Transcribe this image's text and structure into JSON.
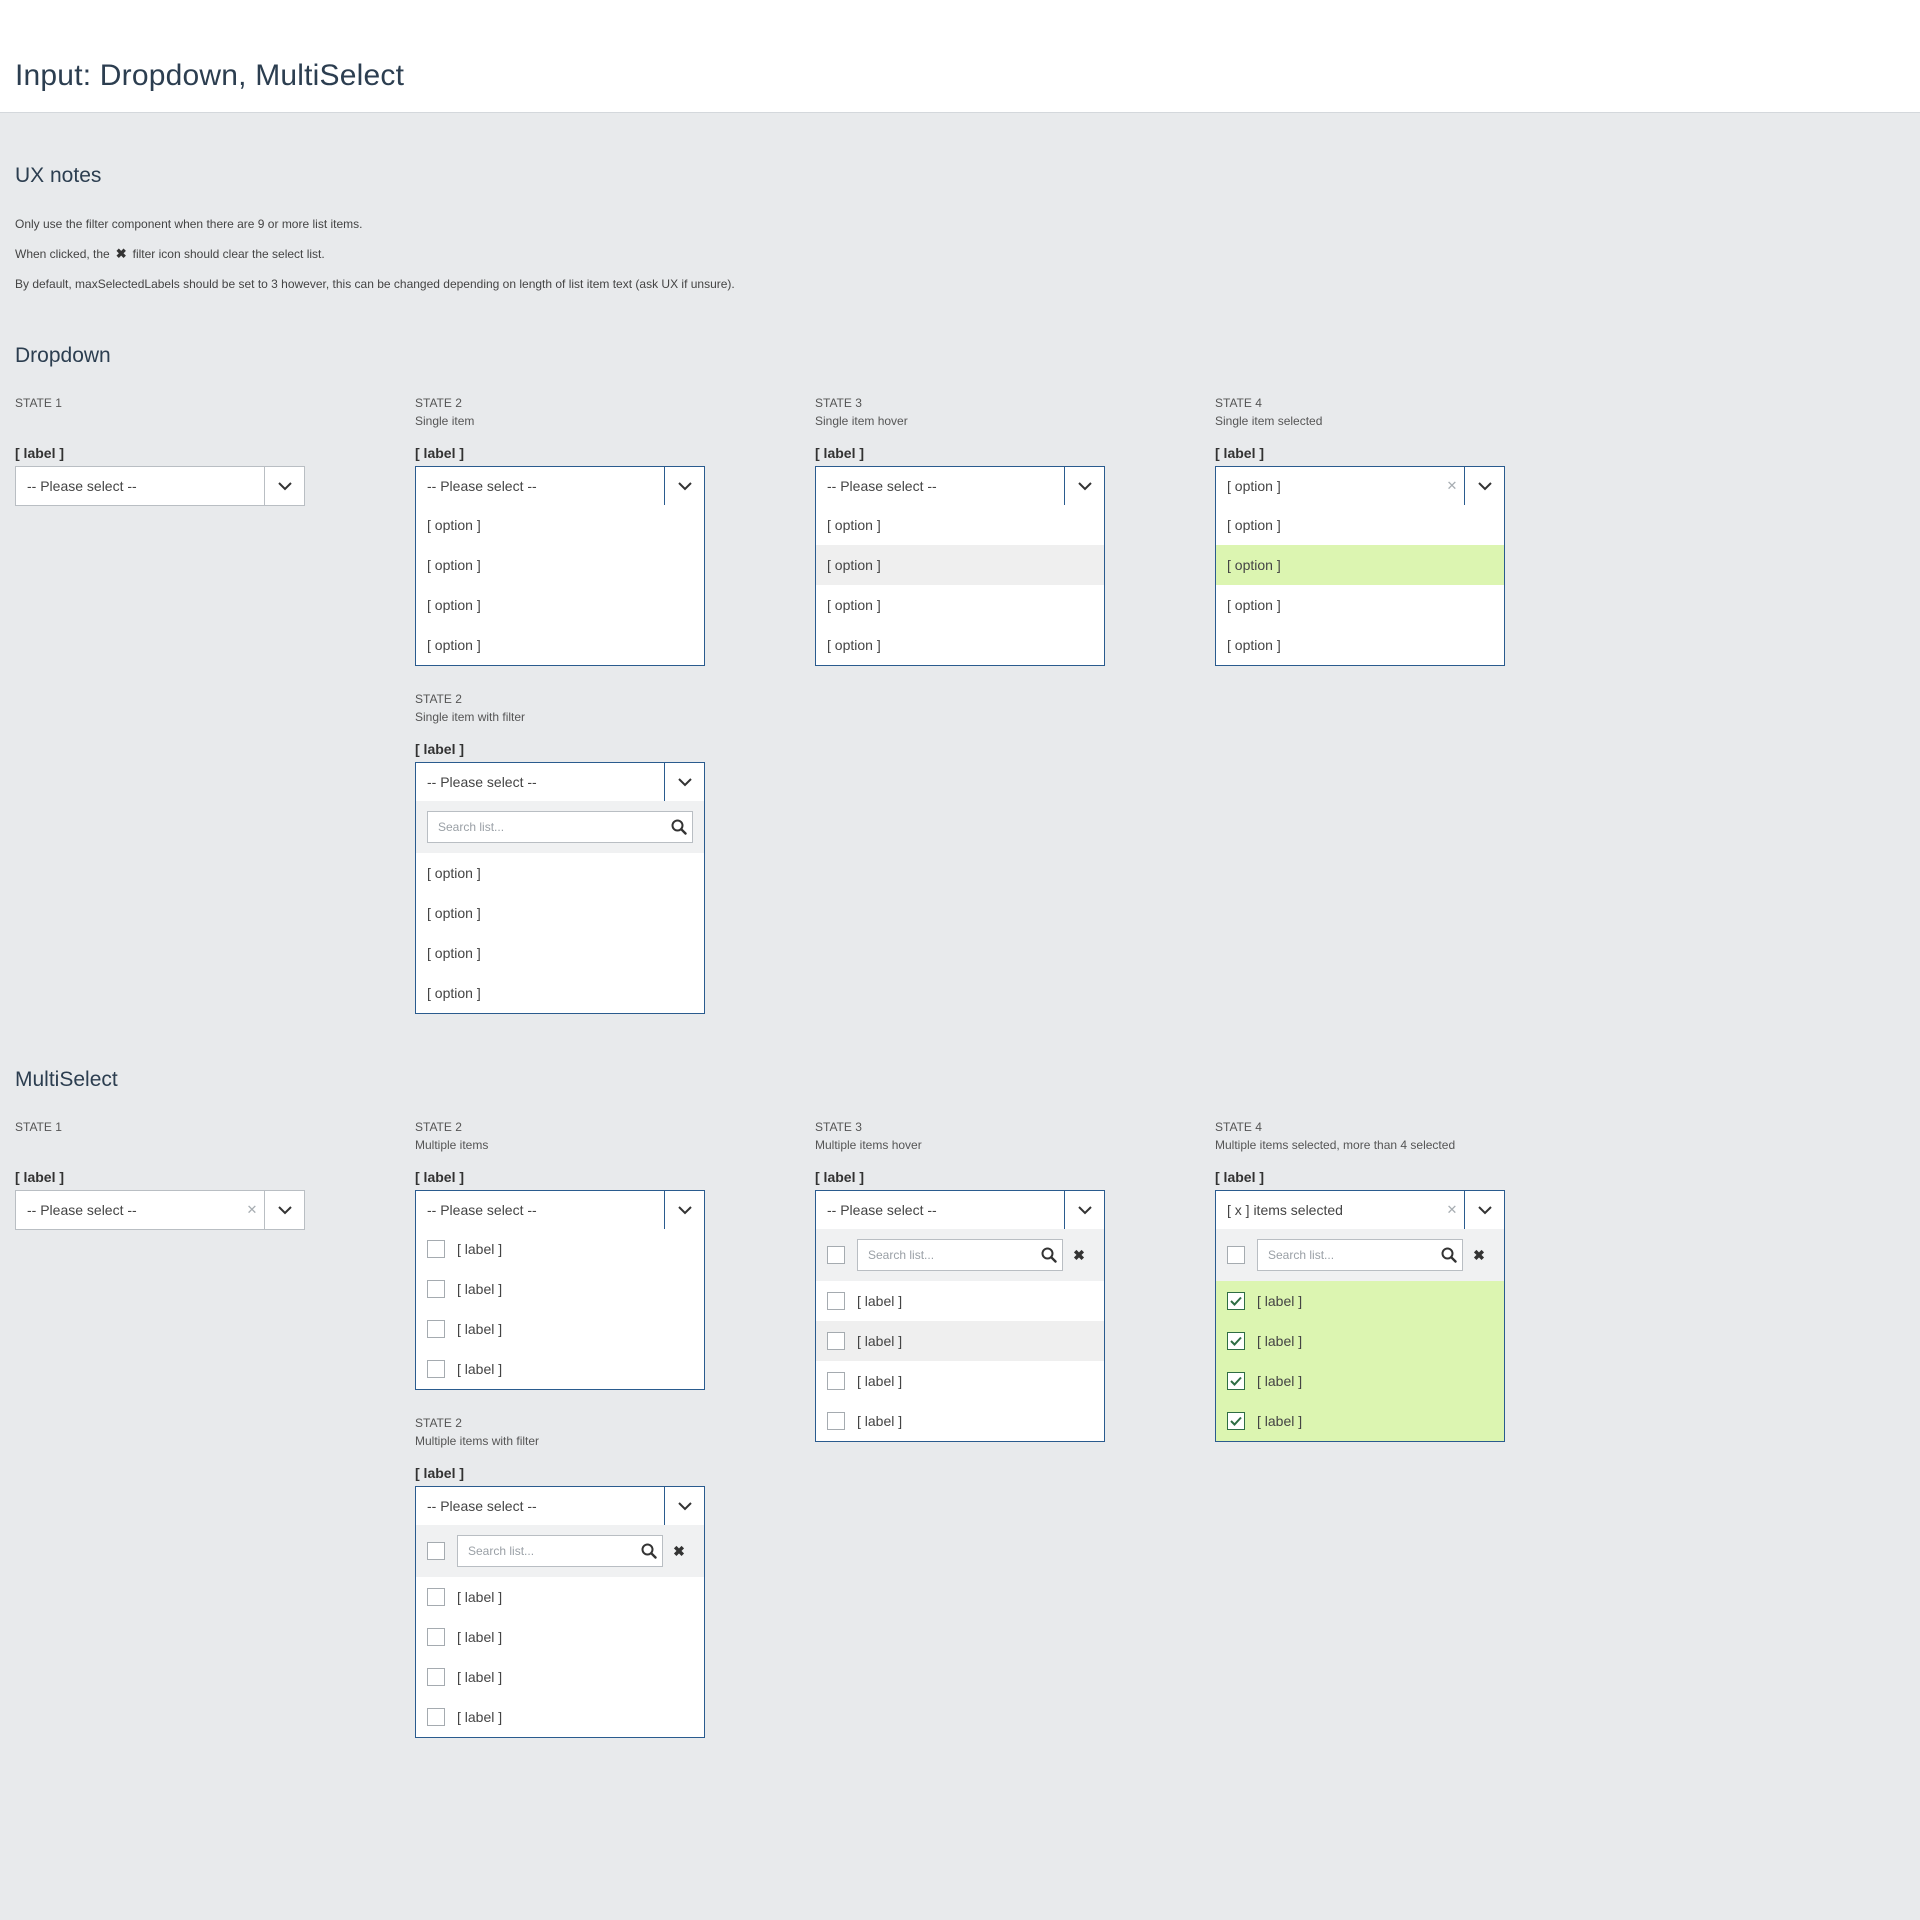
{
  "page": {
    "title": "Input: Dropdown, MultiSelect"
  },
  "ux": {
    "heading": "UX notes",
    "note1": "Only use the filter component when there are 9 or more list items.",
    "note2_before": "When clicked, the",
    "note2_icon": "✖",
    "note2_after": "filter icon should clear the select list.",
    "note3": "By default, maxSelectedLabels should be set to 3 however, this can be changed depending on length of list item text (ask UX if unsure)."
  },
  "dropdown": {
    "heading": "Dropdown",
    "s1": {
      "state": "STATE 1",
      "label": "[ label ]",
      "value": "-- Please select --"
    },
    "s2": {
      "state": "STATE 2",
      "desc": "Single item",
      "label": "[ label ]",
      "value": "-- Please select --",
      "options": [
        "[ option ]",
        "[ option ]",
        "[ option ]",
        "[ option ]"
      ]
    },
    "s3": {
      "state": "STATE 3",
      "desc": "Single item hover",
      "label": "[ label ]",
      "value": "-- Please select --",
      "options": [
        "[ option ]",
        "[ option ]",
        "[ option ]",
        "[ option ]"
      ]
    },
    "s4": {
      "state": "STATE 4",
      "desc": "Single item selected",
      "label": "[ label ]",
      "value": "[ option ]",
      "clear": "✕",
      "options": [
        "[ option ]",
        "[ option ]",
        "[ option ]",
        "[ option ]"
      ]
    },
    "s2f": {
      "state": "STATE 2",
      "desc": "Single item with filter",
      "label": "[ label ]",
      "value": "-- Please select --",
      "search_placeholder": "Search list...",
      "options": [
        "[ option ]",
        "[ option ]",
        "[ option ]",
        "[ option ]"
      ]
    }
  },
  "multiselect": {
    "heading": "MultiSelect",
    "s1": {
      "state": "STATE 1",
      "label": "[ label ]",
      "value": "-- Please select --",
      "clear": "✕"
    },
    "s2": {
      "state": "STATE 2",
      "desc": "Multiple items",
      "label": "[ label ]",
      "value": "-- Please select --",
      "items": [
        "[ label ]",
        "[ label ]",
        "[ label ]",
        "[ label ]"
      ]
    },
    "s3": {
      "state": "STATE 3",
      "desc": "Multiple items hover",
      "label": "[ label ]",
      "value": "-- Please select --",
      "search_placeholder": "Search list...",
      "filter_clear": "✖",
      "items": [
        "[ label ]",
        "[ label ]",
        "[ label ]",
        "[ label ]"
      ]
    },
    "s4": {
      "state": "STATE 4",
      "desc": "Multiple items selected, more than 4 selected",
      "label": "[ label ]",
      "value": "[ x ] items selected",
      "clear": "✕",
      "search_placeholder": "Search list...",
      "filter_clear": "✖",
      "items": [
        "[ label ]",
        "[ label ]",
        "[ label ]",
        "[ label ]"
      ]
    },
    "s2f": {
      "state": "STATE 2",
      "desc": "Multiple items with filter",
      "label": "[ label ]",
      "value": "-- Please select --",
      "search_placeholder": "Search list...",
      "filter_clear": "✖",
      "items": [
        "[ label ]",
        "[ label ]",
        "[ label ]",
        "[ label ]"
      ]
    }
  },
  "colors": {
    "accent_border": "#2a5b8e",
    "selected_bg": "#dcf5b1",
    "hover_bg": "#efefef",
    "check_green": "#2e6d44"
  }
}
